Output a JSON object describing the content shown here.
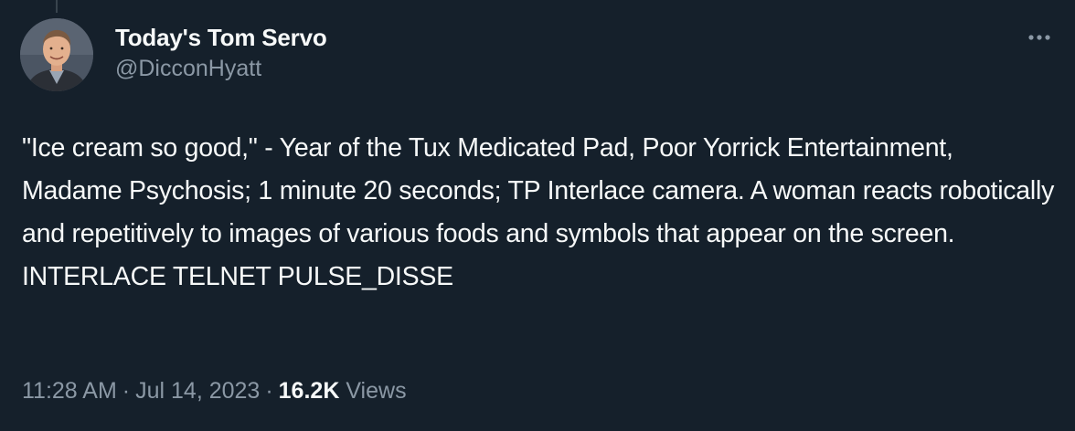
{
  "tweet": {
    "author": {
      "display_name": "Today's Tom Servo",
      "handle": "@DicconHyatt",
      "avatar_icon": "avatar-photo"
    },
    "more_icon": "more-dots-icon",
    "text": "\"Ice cream so good,\" - Year of the Tux Medicated Pad, Poor Yorrick Entertainment, Madame Psychosis; 1 minute 20 seconds; TP Interlace camera. A woman reacts robotically and repetitively to images of various foods and symbols that appear on the screen. INTERLACE TELNET PULSE_DISSE",
    "time": "11:28 AM",
    "date": "Jul 14, 2023",
    "separator": "·",
    "views_count": "16.2K",
    "views_label": "Views"
  },
  "colors": {
    "background": "#15202b",
    "primary_text": "#f7f9f9",
    "secondary_text": "#8b98a5",
    "thread_line": "#38444d"
  }
}
